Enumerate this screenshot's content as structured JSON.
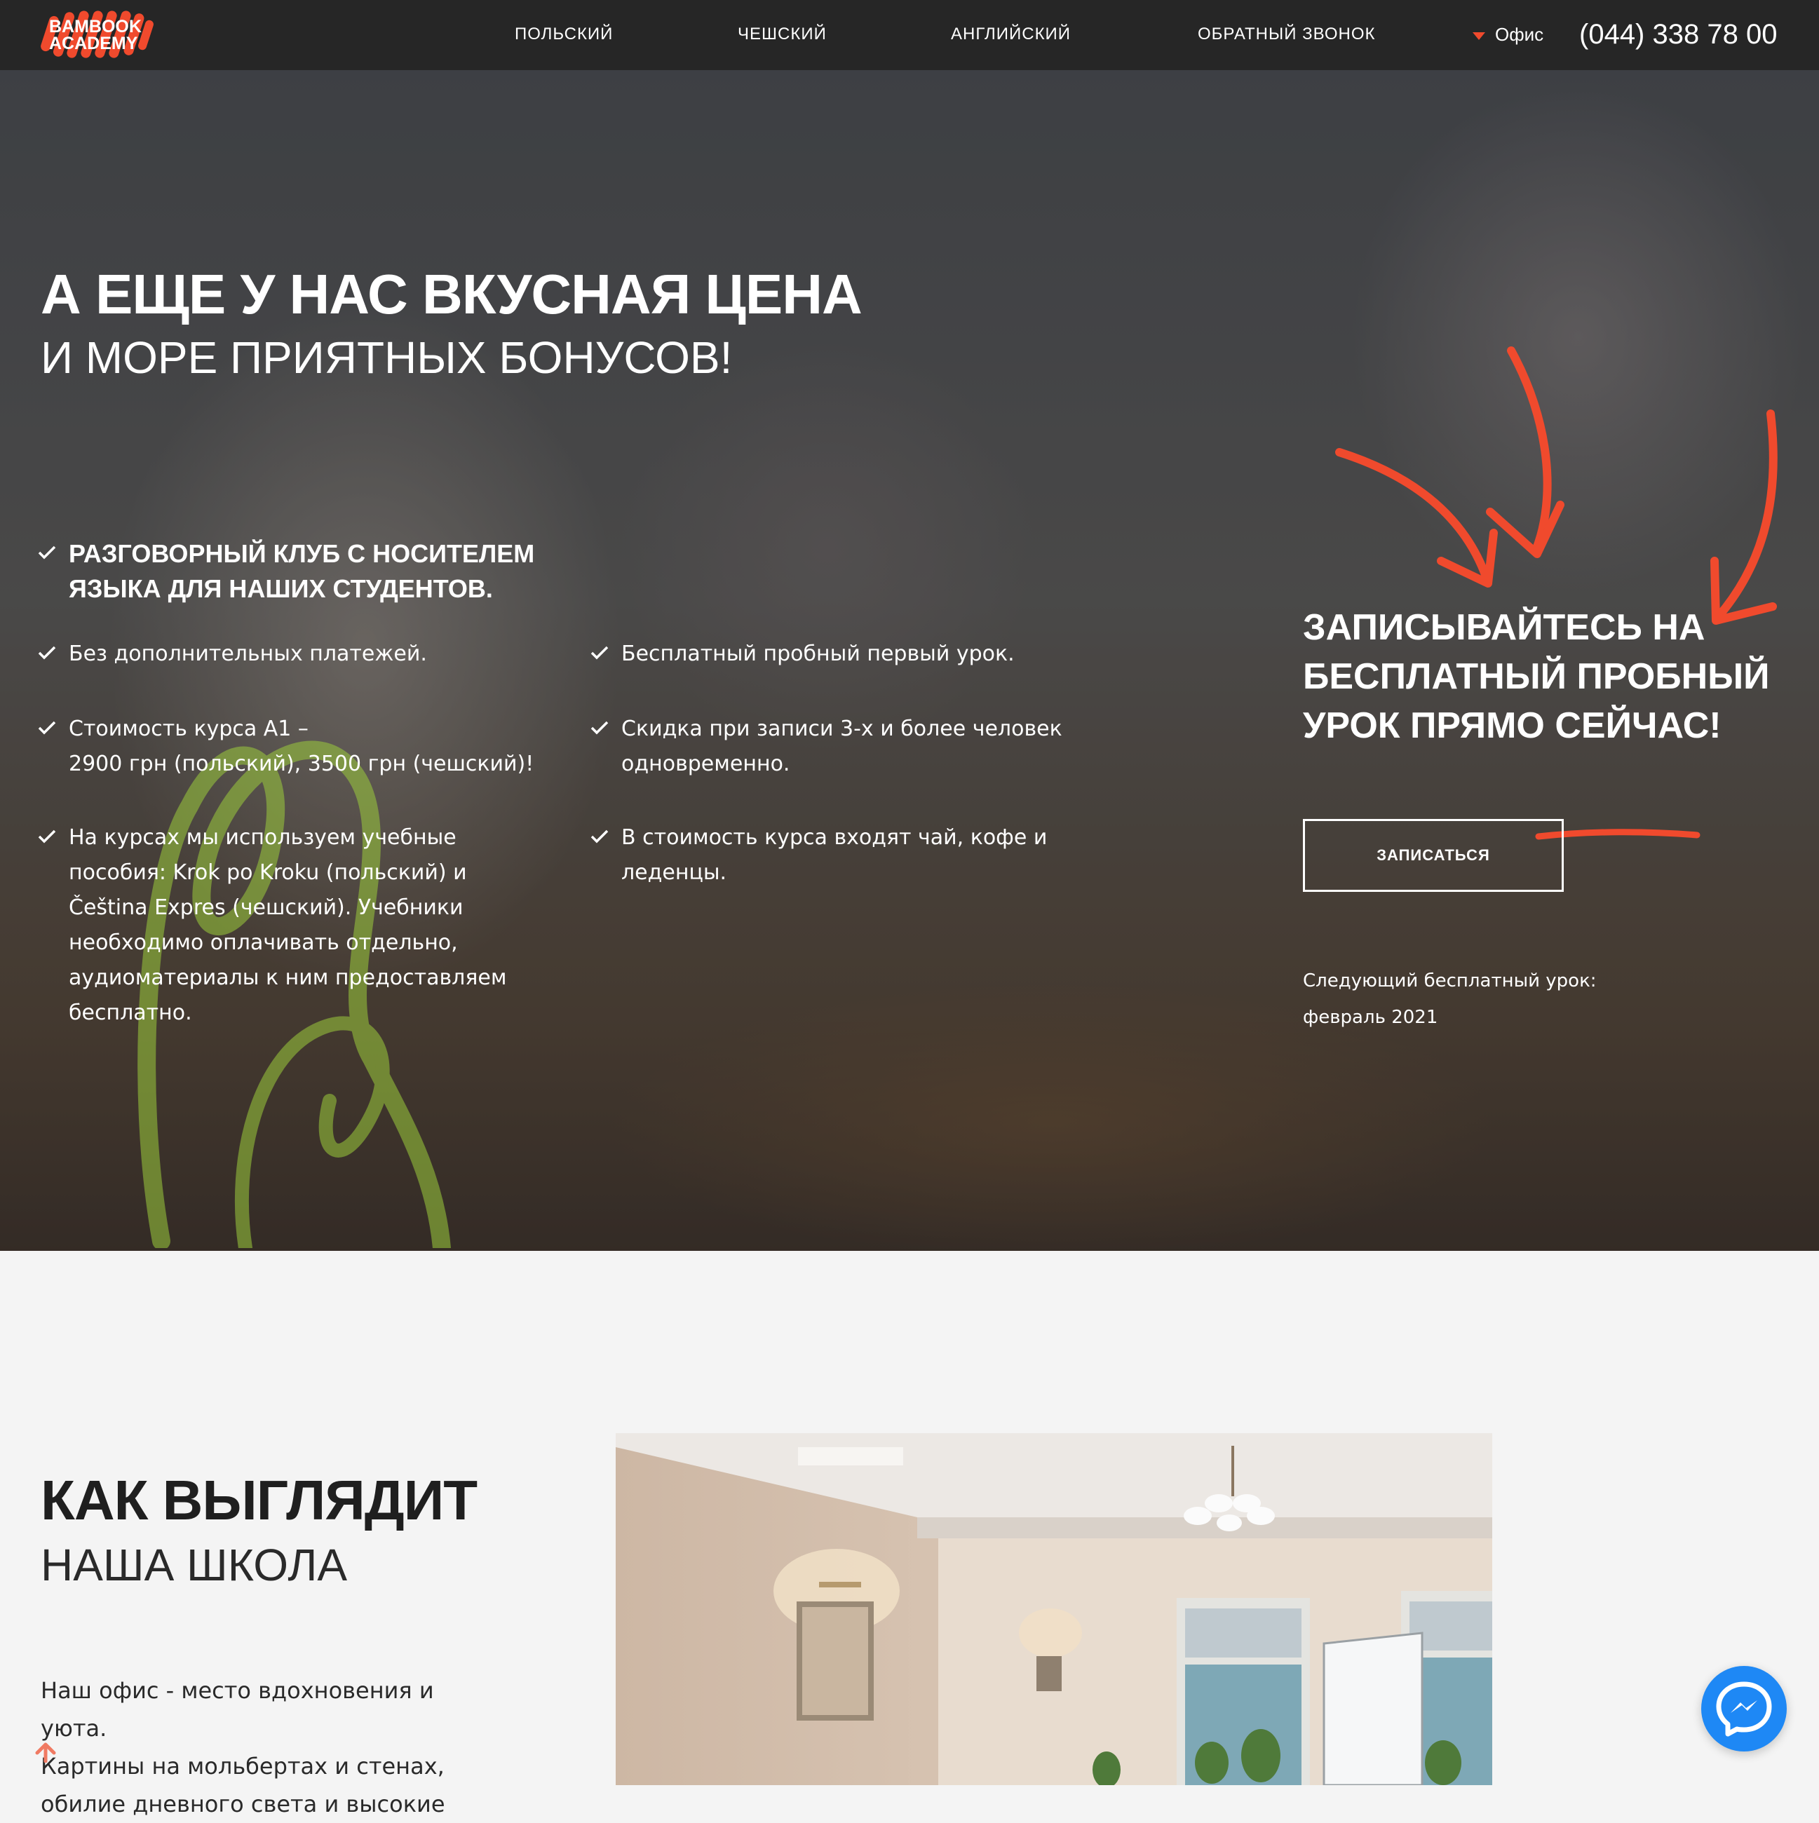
{
  "nav": {
    "logo_line1": "BAMBOOK",
    "logo_line2": "ACADEMY",
    "links": [
      "ПОЛЬСКИЙ",
      "ЧЕШСКИЙ",
      "АНГЛИЙСКИЙ",
      "ОБРАТНЫЙ ЗВОНОК"
    ],
    "office_label": "Офис",
    "phone": "(044) 338 78 00"
  },
  "hero": {
    "title": "А ЕЩЕ У НАС ВКУСНАЯ ЦЕНА",
    "subtitle": "И МОРЕ ПРИЯТНЫХ БОНУСОВ!",
    "club_line1": "РАЗГОВОРНЫЙ КЛУБ С НОСИТЕЛЕМ",
    "club_line2": "ЯЗЫКА ДЛЯ НАШИХ СТУДЕНТОВ.",
    "left_items": [
      {
        "lines": [
          "Без дополнительных платежей."
        ]
      },
      {
        "lines": [
          "Стоимость курса А1 –",
          "2900 грн (польский), 3500 грн (чешский)!"
        ]
      },
      {
        "lines": [
          "На курсах мы используем учебные",
          "пособия: Krok po Kroku (польский) и",
          "Čeština Expres (чешский). Учебники",
          "необходимо оплачивать отдельно,",
          "аудиоматериалы к ним предоставляем",
          "бесплатно."
        ]
      }
    ],
    "right_items": [
      {
        "lines": [
          "Бесплатный пробный первый урок."
        ]
      },
      {
        "lines": [
          "Скидка при записи 3-х и более человек",
          "одновременно."
        ]
      },
      {
        "lines": [
          "В стоимость курса входят чай, кофе и",
          "леденцы."
        ]
      }
    ],
    "cta_line1": "ЗАПИСЫВАЙТЕСЬ НА",
    "cta_line2": "БЕСПЛАТНЫЙ ПРОБНЫЙ",
    "cta_line3": "УРОК ПРЯМО СЕЙЧАС!",
    "button_label": "ЗАПИСАТЬСЯ",
    "next_label": "Следующий бесплатный урок:",
    "next_date": "февраль 2021"
  },
  "school": {
    "title": "КАК ВЫГЛЯДИТ",
    "subtitle": "НАША ШКОЛА",
    "text_lines": [
      "Наш офис - место вдохновения и уюта.",
      "Картины на мольбертах и стенах,",
      "обилие дневного света и высокие"
    ]
  },
  "colors": {
    "accent": "#f04a2d",
    "nav_bg": "#262626",
    "messenger": "#1e88f5"
  },
  "icons": [
    "check-icon",
    "dropdown-triangle-icon",
    "scroll-up-arrow-icon",
    "messenger-icon"
  ]
}
